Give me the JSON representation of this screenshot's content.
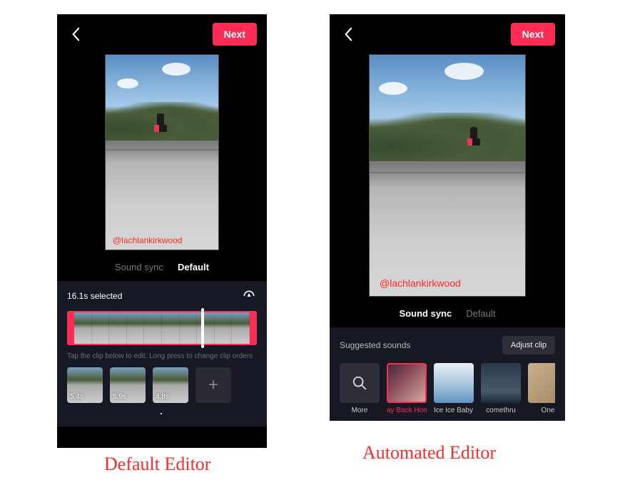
{
  "sharedHeader": {
    "next": "Next"
  },
  "watermark": "@lachlankirkwood",
  "tabs": {
    "soundSync": "Sound sync",
    "default": "Default"
  },
  "leftPhone": {
    "selected": "16.1s selected",
    "hint": "Tap the clip below to edit. Long press to change clip orders",
    "clips": [
      "5.4s",
      "5.9s",
      "4.8s"
    ]
  },
  "rightPhone": {
    "suggestedLabel": "Suggested sounds",
    "adjustClip": "Adjust clip",
    "sounds": [
      {
        "label": "More"
      },
      {
        "label": "ay Back Home"
      },
      {
        "label": "Ice Ice Baby ("
      },
      {
        "label": "comethru"
      },
      {
        "label": "One"
      }
    ]
  },
  "captions": {
    "left": "Default Editor",
    "right": "Automated Editor"
  }
}
